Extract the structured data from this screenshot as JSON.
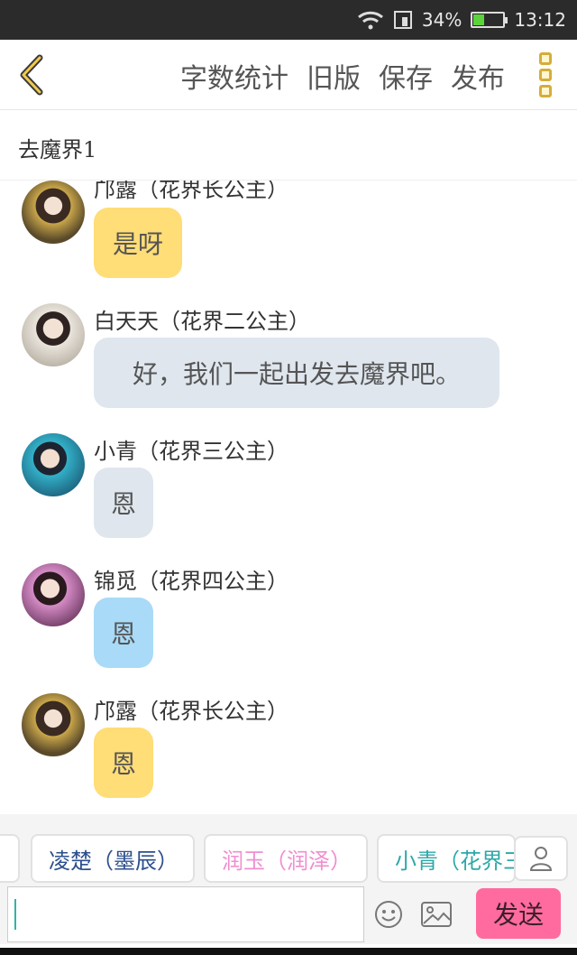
{
  "status": {
    "battery": "34%",
    "time": "13:12"
  },
  "toolbar": {
    "word_count": "字数统计",
    "old_version": "旧版",
    "save": "保存",
    "publish": "发布"
  },
  "chapter": {
    "title": "去魔界1"
  },
  "messages": [
    {
      "name": "邝露（花界长公主）",
      "text": "是呀",
      "color": "#ffdd77"
    },
    {
      "name": "白天天（花界二公主）",
      "text": "好，我们一起出发去魔界吧。",
      "color": "#dfe6ee"
    },
    {
      "name": "小青（花界三公主）",
      "text": "恩",
      "color": "#dfe6ee"
    },
    {
      "name": "锦觅（花界四公主）",
      "text": "恩",
      "color": "#a9daf7"
    },
    {
      "name": "邝露（花界长公主）",
      "text": "恩",
      "color": "#ffdd77"
    }
  ],
  "characters": [
    {
      "label": "凌楚（墨辰）",
      "color": "#2d4f8c"
    },
    {
      "label": "润玉（润泽）",
      "color": "#f08fd0"
    },
    {
      "label": "小青（花界三公主）",
      "color": "#2ea8a8"
    }
  ],
  "input": {
    "value": ""
  },
  "send_label": "发送",
  "icons": {
    "back": "chevron-left-icon",
    "more": "more-vertical-icon",
    "person": "person-icon",
    "emoji": "smiley-icon",
    "image": "image-icon"
  },
  "colors": {
    "accent": "#d6ad3a",
    "send": "#ff6b9f"
  }
}
